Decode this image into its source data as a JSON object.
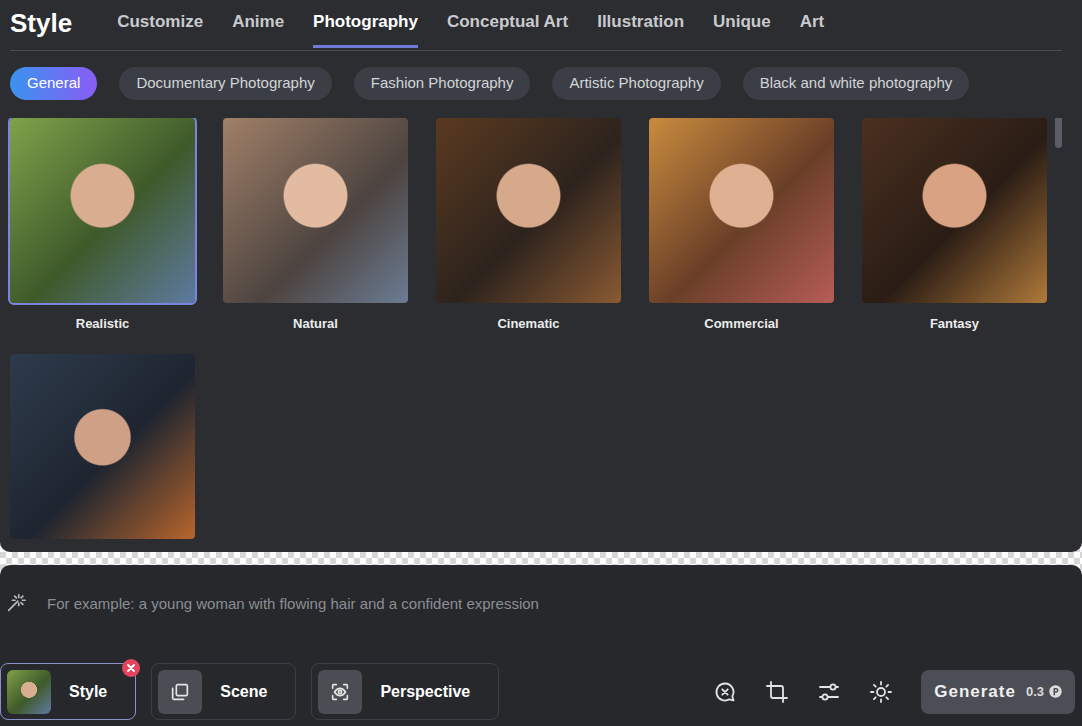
{
  "panel": {
    "title": "Style"
  },
  "tabs": [
    {
      "label": "Customize",
      "selected": false
    },
    {
      "label": "Anime",
      "selected": false
    },
    {
      "label": "Photography",
      "selected": true
    },
    {
      "label": "Conceptual Art",
      "selected": false
    },
    {
      "label": "Illustration",
      "selected": false
    },
    {
      "label": "Unique",
      "selected": false
    },
    {
      "label": "Art",
      "selected": false
    }
  ],
  "subtabs": [
    {
      "label": "General",
      "selected": true
    },
    {
      "label": "Documentary Photography",
      "selected": false
    },
    {
      "label": "Fashion Photography",
      "selected": false
    },
    {
      "label": "Artistic Photography",
      "selected": false
    },
    {
      "label": "Black and white photography",
      "selected": false
    }
  ],
  "styles": [
    {
      "label": "Realistic",
      "selected": true
    },
    {
      "label": "Natural",
      "selected": false
    },
    {
      "label": "Cinematic",
      "selected": false
    },
    {
      "label": "Commercial",
      "selected": false
    },
    {
      "label": "Fantasy",
      "selected": false
    },
    {
      "selected": false
    }
  ],
  "prompt": {
    "placeholder": "For example: a young woman with flowing hair and a confident expression"
  },
  "chips": [
    {
      "label": "Style",
      "kind": "thumbnail",
      "selected": true
    },
    {
      "label": "Scene",
      "kind": "icon",
      "selected": false
    },
    {
      "label": "Perspective",
      "kind": "icon",
      "selected": false
    }
  ],
  "generate": {
    "label": "Generate",
    "cost": "0.3"
  }
}
